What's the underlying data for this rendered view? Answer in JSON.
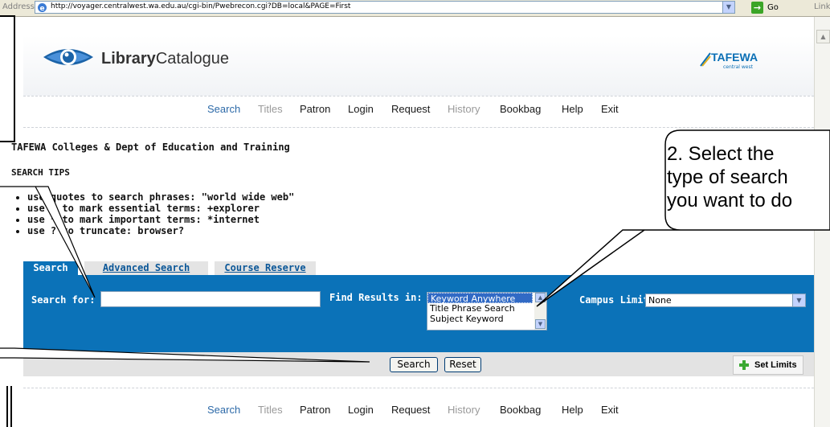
{
  "browser": {
    "address_label": "Address",
    "url": "http://voyager.centralwest.wa.edu.au/cgi-bin/Pwebrecon.cgi?DB=local&PAGE=First",
    "go_label": "Go",
    "links_label": "Links"
  },
  "header": {
    "logo_bold": "Library",
    "logo_regular": "Catalogue",
    "partner_logo": "TAFEWA",
    "partner_sub": "central west"
  },
  "nav": {
    "items": [
      {
        "label": "Search",
        "state": "active"
      },
      {
        "label": "Titles",
        "state": "disabled"
      },
      {
        "label": "Patron",
        "state": "normal"
      },
      {
        "label": "Login",
        "state": "normal"
      },
      {
        "label": "Request",
        "state": "normal"
      },
      {
        "label": "History",
        "state": "disabled"
      },
      {
        "label": "Bookbag",
        "state": "normal"
      },
      {
        "label": "Help",
        "state": "normal"
      },
      {
        "label": "Exit",
        "state": "normal"
      }
    ]
  },
  "content": {
    "org_name": "TAFEWA Colleges & Dept of Education and Training",
    "tips_heading": "SEARCH TIPS",
    "tips": [
      "use quotes to search phrases: \"world wide web\"",
      "use + to mark essential terms: +explorer",
      "use * to mark important terms: *internet",
      "use ? to truncate: browser?"
    ]
  },
  "search": {
    "tabs": [
      {
        "label": "Search",
        "active": true
      },
      {
        "label": "Advanced Search",
        "active": false
      },
      {
        "label": "Course Reserve",
        "active": false
      }
    ],
    "search_for_label": "Search for:",
    "search_for_value": "",
    "find_results_label": "Find Results in:",
    "find_results_options": [
      "Keyword Anywhere",
      "Title Phrase Search",
      "Subject Keyword"
    ],
    "find_results_selected": "Keyword Anywhere",
    "campus_limit_label": "Campus Limit:",
    "campus_limit_value": "None",
    "search_button": "Search",
    "reset_button": "Reset",
    "set_limits_button": "Set Limits"
  },
  "annotation": {
    "line1": "2. Select the",
    "line2": "type of search",
    "line3": "you want to do"
  },
  "colors": {
    "panel_blue": "#0b72b8",
    "nav_active": "#2d6aa8",
    "nav_disabled": "#9a9a9a"
  }
}
